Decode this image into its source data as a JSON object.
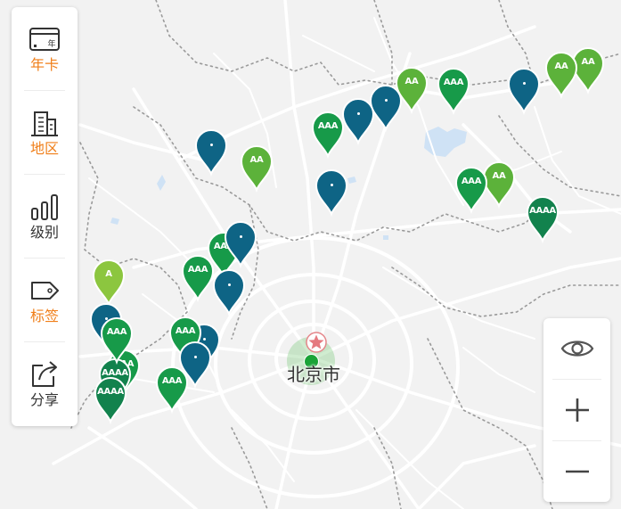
{
  "sidebar": {
    "items": [
      {
        "label": "年卡",
        "icon": "card-icon",
        "color": "#f07f1a"
      },
      {
        "label": "地区",
        "icon": "buildings-icon",
        "color": "#f07f1a"
      },
      {
        "label": "级别",
        "icon": "bar-chart-icon",
        "color": "#333333"
      },
      {
        "label": "标签",
        "icon": "tag-icon",
        "color": "#f07f1a"
      },
      {
        "label": "分享",
        "icon": "share-icon",
        "color": "#333333"
      }
    ],
    "card_badge": "年"
  },
  "map": {
    "city_label": "北京市",
    "marker_colors": {
      "A": "#8cc63f",
      "AA": "#5cb23a",
      "AAA": "#179a49",
      "AAAA": "#12824d",
      "AAAAA": "#0e6485"
    },
    "markers": [
      {
        "level": "AAA",
        "label": "AAA"
      },
      {
        "level": "AAAA",
        "label": "AAAA"
      },
      {
        "level": "AA",
        "label": "AA"
      },
      {
        "level": "AA",
        "label": "AA"
      },
      {
        "level": "AAA",
        "label": "AAA"
      },
      {
        "level": "AAAAA",
        "label": ""
      },
      {
        "level": "AAAAA",
        "label": ""
      },
      {
        "level": "AA",
        "label": "AA"
      },
      {
        "level": "AA",
        "label": "AA"
      },
      {
        "level": "AAA",
        "label": "AAA"
      },
      {
        "level": "AAAA",
        "label": "AAAA"
      },
      {
        "level": "AAAAA",
        "label": ""
      },
      {
        "level": "AAA",
        "label": "AAA"
      },
      {
        "level": "AA",
        "label": "AA"
      },
      {
        "level": "AAAAA",
        "label": ""
      },
      {
        "level": "AAAAA",
        "label": ""
      },
      {
        "level": "AAA",
        "label": "AAA"
      },
      {
        "level": "AAA",
        "label": "AAA"
      },
      {
        "level": "AAAAA",
        "label": ""
      },
      {
        "level": "A",
        "label": "A"
      },
      {
        "level": "AAAAA",
        "label": ""
      },
      {
        "level": "AAAAA",
        "label": ""
      },
      {
        "level": "AAA",
        "label": "AAA"
      },
      {
        "level": "AAAAA",
        "label": ""
      },
      {
        "level": "AAA",
        "label": "AAA"
      },
      {
        "level": "AAAAA",
        "label": ""
      },
      {
        "level": "AAA",
        "label": "AAA"
      },
      {
        "level": "AAAA",
        "label": "AAAA"
      }
    ]
  },
  "controls": {
    "items": [
      {
        "icon": "eye-icon"
      },
      {
        "icon": "plus-icon"
      },
      {
        "icon": "minus-icon"
      }
    ]
  }
}
